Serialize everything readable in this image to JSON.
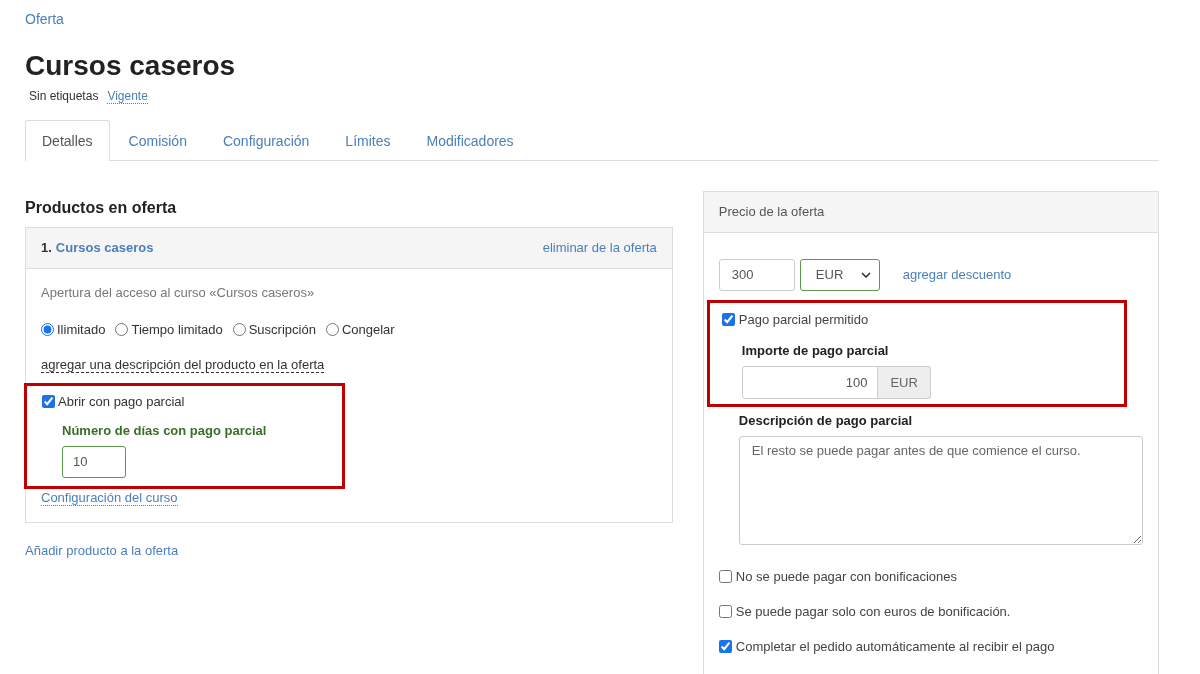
{
  "breadcrumb": "Oferta",
  "title": "Cursos caseros",
  "tags_label": "Sin etiquetas",
  "status_link": "Vigente",
  "tabs": [
    {
      "label": "Detalles",
      "selected": true
    },
    {
      "label": "Comisión",
      "selected": false
    },
    {
      "label": "Configuración",
      "selected": false
    },
    {
      "label": "Límites",
      "selected": false
    },
    {
      "label": "Modificadores",
      "selected": false
    }
  ],
  "products": {
    "heading": "Productos en oferta",
    "items": [
      {
        "number": "1.",
        "name": "Cursos caseros",
        "remove_link": "eliminar de la oferta",
        "access_text": "Apertura del acceso al curso «Cursos caseros»",
        "access_options": [
          {
            "label": "Ilimitado",
            "selected": true
          },
          {
            "label": "Tiempo limitado",
            "selected": false
          },
          {
            "label": "Suscripción",
            "selected": false
          },
          {
            "label": "Congelar",
            "selected": false
          }
        ],
        "description_link": "agregar una descripción del producto en la oferta",
        "partial": {
          "highlighted": true,
          "label": "Abrir con pago parcial",
          "checked": true,
          "days_label": "Número de días con pago parcial",
          "days_value": "10"
        },
        "settings_link": "Configuración del curso"
      }
    ],
    "add_link": "Añadir producto a la oferta"
  },
  "price": {
    "heading": "Precio de la oferta",
    "amount": "300",
    "currency": "EUR",
    "discount_link": "agregar descuento",
    "partial": {
      "highlighted": true,
      "label": "Pago parcial permitido",
      "checked": true,
      "amount_label": "Importe de pago parcial",
      "amount_value": "100",
      "amount_unit": "EUR"
    },
    "description_label": "Descripción de pago parcial",
    "description_value": "El resto se puede pagar antes de que comience el curso.",
    "options": [
      {
        "label": "No se puede pagar con bonificaciones",
        "checked": false
      },
      {
        "label": "Se puede pagar solo con euros de bonificación.",
        "checked": false
      },
      {
        "label": "Completar el pedido automáticamente al recibir el pago",
        "checked": true
      }
    ]
  }
}
